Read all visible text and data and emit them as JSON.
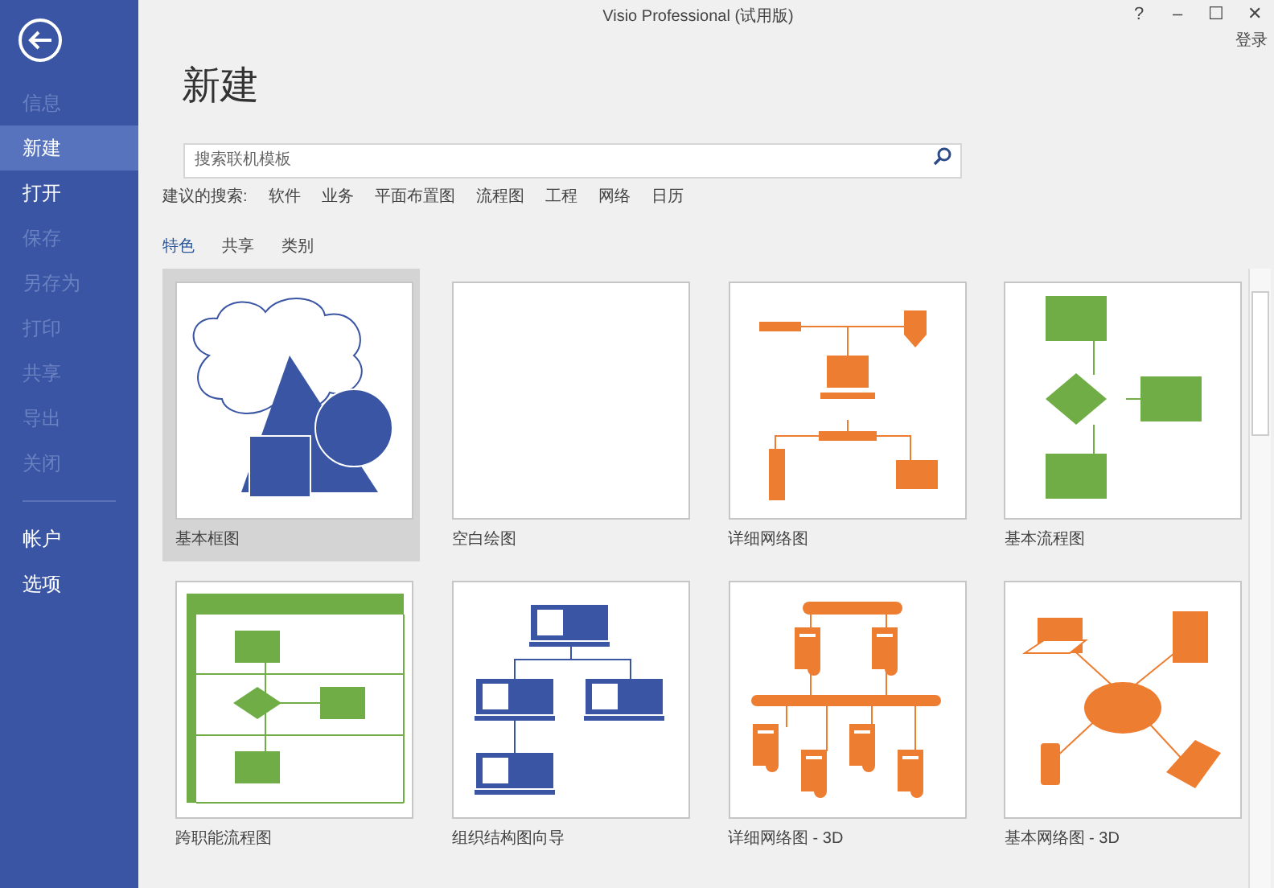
{
  "window": {
    "title": "Visio Professional (试用版)",
    "controls": [
      "?",
      "–",
      "☐",
      "✕"
    ],
    "sign_in": "登录"
  },
  "sidebar": {
    "items": [
      {
        "label": "信息",
        "selected": false,
        "disabled": true
      },
      {
        "label": "新建",
        "selected": true,
        "disabled": false
      },
      {
        "label": "打开",
        "selected": false,
        "disabled": false
      },
      {
        "label": "保存",
        "selected": false,
        "disabled": true
      },
      {
        "label": "另存为",
        "selected": false,
        "disabled": true
      },
      {
        "label": "打印",
        "selected": false,
        "disabled": true
      },
      {
        "label": "共享",
        "selected": false,
        "disabled": true
      },
      {
        "label": "导出",
        "selected": false,
        "disabled": true
      },
      {
        "label": "关闭",
        "selected": false,
        "disabled": true
      }
    ],
    "bottom_items": [
      {
        "label": "帐户",
        "selected": false,
        "disabled": false
      },
      {
        "label": "选项",
        "selected": false,
        "disabled": false
      }
    ]
  },
  "page_title": "新建",
  "search": {
    "placeholder": "搜索联机模板"
  },
  "suggested": {
    "label": "建议的搜索:",
    "links": [
      "软件",
      "业务",
      "平面布置图",
      "流程图",
      "工程",
      "网络",
      "日历"
    ]
  },
  "tabs": [
    {
      "label": "特色",
      "selected": true
    },
    {
      "label": "共享",
      "selected": false
    },
    {
      "label": "类别",
      "selected": false
    }
  ],
  "templates": [
    {
      "label": "基本框图",
      "kind": "basic",
      "selected": true
    },
    {
      "label": "空白绘图",
      "kind": "blank",
      "selected": false
    },
    {
      "label": "详细网络图",
      "kind": "network",
      "selected": false
    },
    {
      "label": "基本流程图",
      "kind": "flowchart",
      "selected": false
    },
    {
      "label": "跨职能流程图",
      "kind": "crossfunctional",
      "selected": false
    },
    {
      "label": "组织结构图向导",
      "kind": "org",
      "selected": false
    },
    {
      "label": "详细网络图 - 3D",
      "kind": "network3d",
      "selected": false
    },
    {
      "label": "基本网络图 - 3D",
      "kind": "basicnetwork3d",
      "selected": false
    }
  ]
}
